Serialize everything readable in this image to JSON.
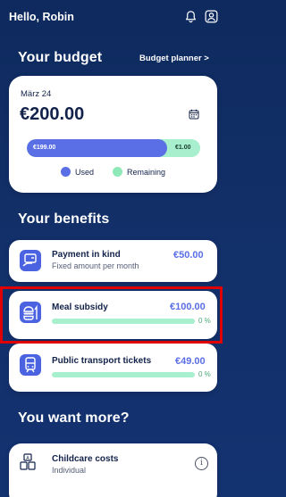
{
  "header": {
    "greeting": "Hello, Robin",
    "icons": [
      "bell-icon",
      "user-icon"
    ]
  },
  "budget": {
    "title": "Your budget",
    "planner_link": "Budget planner >",
    "month": "März 24",
    "amount": "€200.00",
    "used_label": "€199.00",
    "remaining_label": "€1.00",
    "used_fraction": 0.81,
    "legend_used": "Used",
    "legend_remaining": "Remaining",
    "colors": {
      "used": "#5a6ee6",
      "remaining": "#a8f0cd"
    }
  },
  "benefits": {
    "title": "Your benefits",
    "items": [
      {
        "title": "Payment in kind",
        "subtitle": "Fixed amount per month",
        "amount": "€50.00",
        "icon": "payment-icon"
      },
      {
        "title": "Meal subsidy",
        "amount": "€100.00",
        "percent": "0 %",
        "progress": 0,
        "icon": "meal-icon"
      },
      {
        "title": "Public transport tickets",
        "amount": "€49.00",
        "percent": "0 %",
        "progress": 0,
        "icon": "train-icon"
      }
    ]
  },
  "more": {
    "title": "You want more?",
    "items": [
      {
        "title": "Childcare costs",
        "subtitle": "Individual",
        "icon": "childcare-icon"
      }
    ],
    "next_partial": ""
  }
}
